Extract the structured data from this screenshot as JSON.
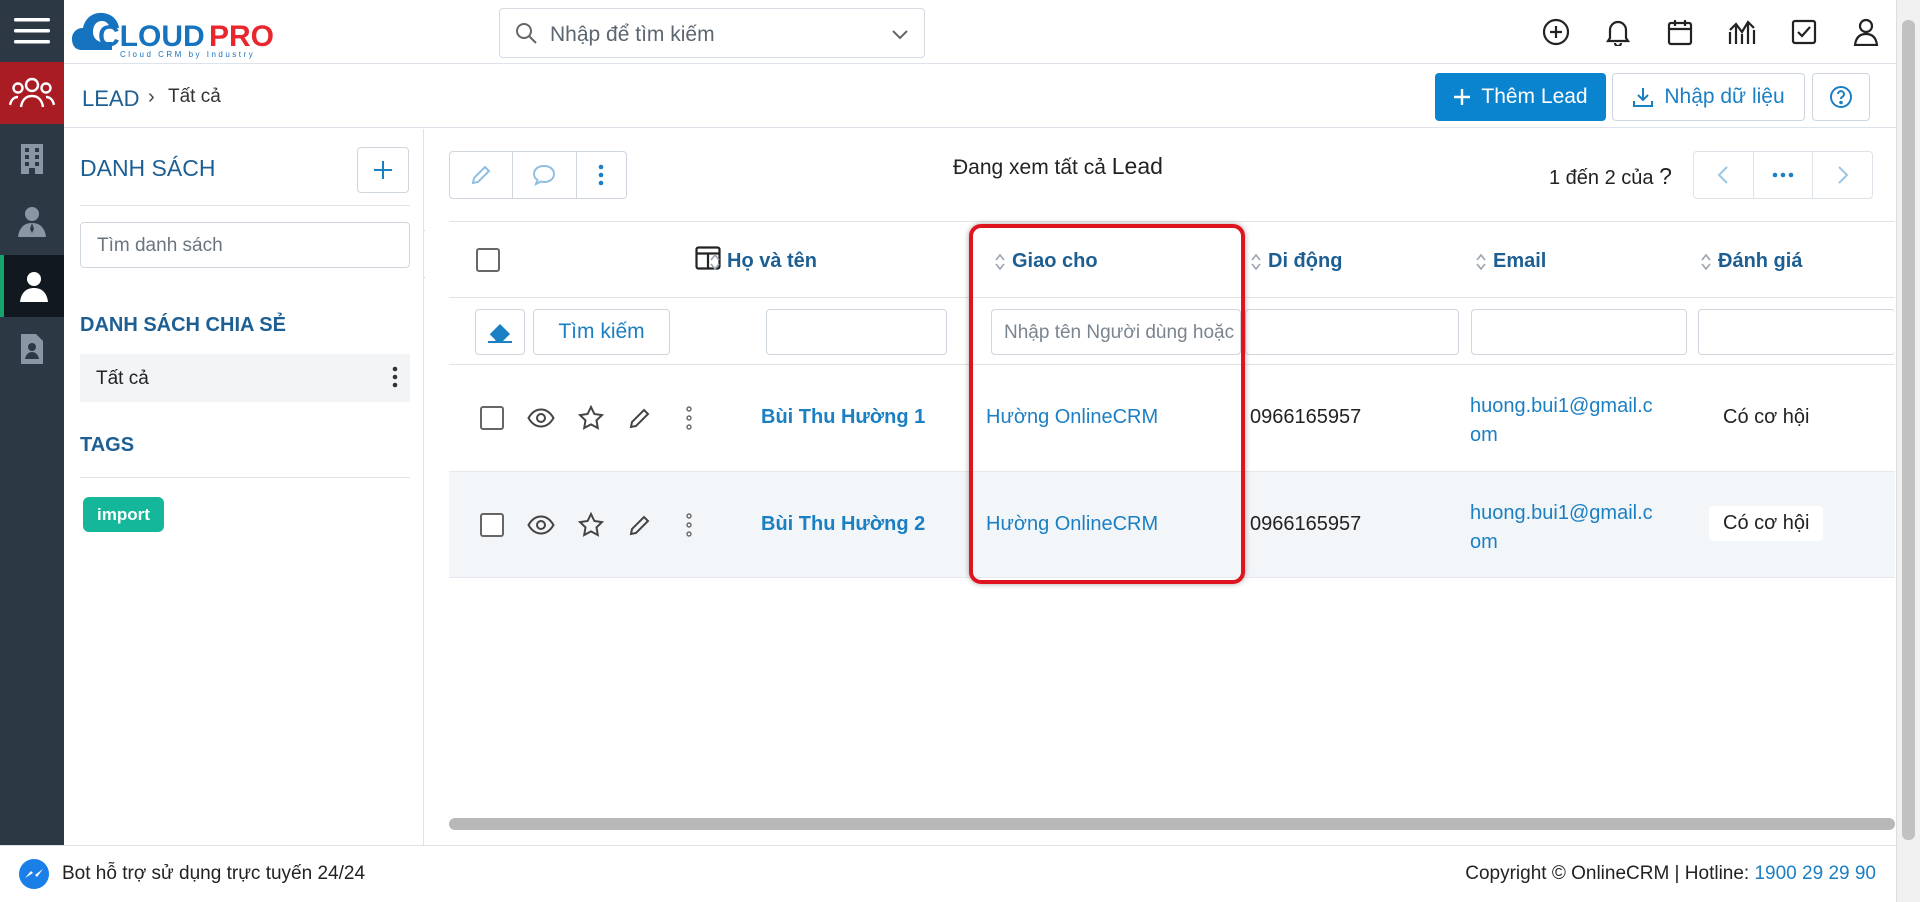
{
  "brand": {
    "name": "CLOUDPRO",
    "tagline": "Cloud CRM by Industry",
    "colors": {
      "primary": "#0a84ce",
      "accent": "#15b79a",
      "highlight": "#e0141e"
    }
  },
  "search": {
    "placeholder": "Nhập để tìm kiếm"
  },
  "top_icons": [
    "plus-circle-icon",
    "bell-icon",
    "calendar-icon",
    "chart-icon",
    "checkbox-icon",
    "user-icon"
  ],
  "breadcrumb": {
    "module": "LEAD",
    "current": "Tất cả"
  },
  "actions": {
    "add_label": "Thêm Lead",
    "import_label": "Nhập dữ liệu"
  },
  "left": {
    "list_title": "DANH SÁCH",
    "search_placeholder": "Tìm danh sách",
    "shared_title": "DANH SÁCH CHIA SẺ",
    "shared_item": "Tất cả",
    "tags_title": "TAGS",
    "tag": "import"
  },
  "main": {
    "viewing_prefix": "Đang xem tất cả",
    "viewing_module": "Lead",
    "pager_text": "1 đến 2 của",
    "pager_q": "?",
    "filter_search": "Tìm kiếm",
    "assign_placeholder": "Nhập tên Người dùng hoặc Nhóm"
  },
  "columns": {
    "name": "Họ và tên",
    "assigned": "Giao cho",
    "mobile": "Di động",
    "email": "Email",
    "rating": "Đánh giá"
  },
  "rows": [
    {
      "name": "Bùi Thu Hường 1",
      "assigned": "Hường OnlineCRM",
      "mobile": "0966165957",
      "email_1": "huong.bui1@gmail.c",
      "email_2": "om",
      "rating": "Có cơ hội"
    },
    {
      "name": "Bùi Thu Hường 2",
      "assigned": "Hường OnlineCRM",
      "mobile": "0966165957",
      "email_1": "huong.bui1@gmail.c",
      "email_2": "om",
      "rating": "Có cơ hội"
    }
  ],
  "footer": {
    "bot": "Bot hỗ trợ sử dụng trực tuyến 24/24",
    "copyright": "Copyright © OnlineCRM | Hotline: ",
    "hotline": "1900 29 29 90"
  }
}
